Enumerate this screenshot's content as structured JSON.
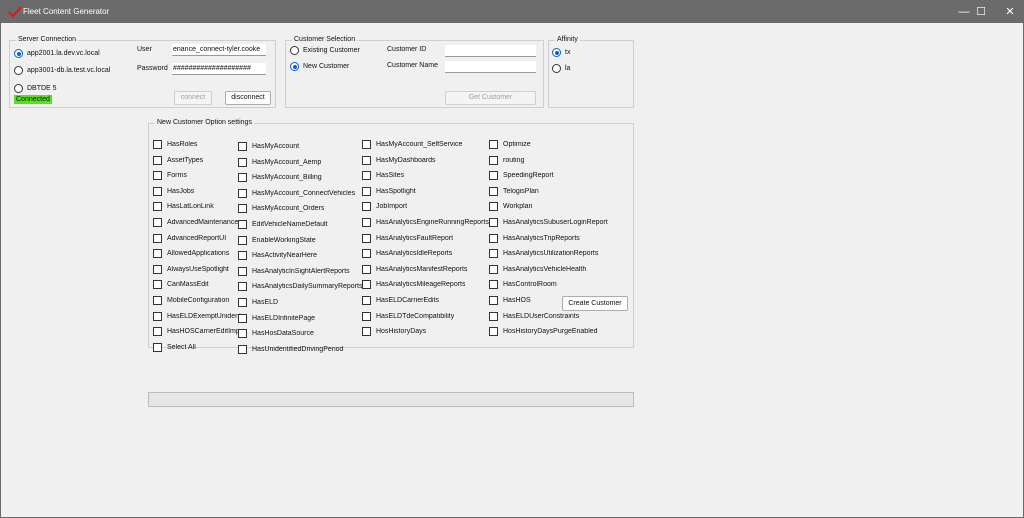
{
  "window": {
    "title": "Fleet Content Generator",
    "minimize": "—",
    "maximize": "☐",
    "close": "✕"
  },
  "server": {
    "group_label": "Server Connection",
    "options": [
      "app2001.la.dev.vc.local",
      "app3001-db.la.test.vc.local",
      "DBTDE 5"
    ],
    "selected": "app2001.la.dev.vc.local",
    "user_label": "User",
    "user_value": "enance_connect-tyler.cooke",
    "password_label": "Password",
    "password_value": "####################",
    "connect_label": "connect",
    "disconnect_label": "disconnect",
    "status": "Connected",
    "status_color": "#56e01f"
  },
  "customer": {
    "group_label": "Customer Selection",
    "options": [
      "Existing Customer",
      "New Customer"
    ],
    "selected": "New Customer",
    "id_label": "Customer ID",
    "id_value": "",
    "name_label": "Customer Name",
    "name_value": "",
    "get_label": "Get Customer"
  },
  "affinity": {
    "group_label": "Affinity",
    "options": [
      "tx",
      "la"
    ],
    "selected": "tx"
  },
  "options": {
    "group_label": "New Customer Option settings",
    "columns": [
      [
        "HasRoles",
        "AssetTypes",
        "Forms",
        "HasJobs",
        "HasLatLonLink",
        "AdvancedMaintenance",
        "AdvancedReportUI",
        "AllowedApplications",
        "AlwaysUseSpotlight",
        "CanMassEdit",
        "MobileConfiguration",
        "HasELDExemptUnidenti",
        "HasHOSCarrierEditImpro",
        "Select All"
      ],
      [
        "HasMyAccount",
        "HasMyAccount_Aemp",
        "HasMyAccount_Billing",
        "HasMyAccount_ConnectVehicles",
        "HasMyAccount_Orders",
        "EditVehicleNameDefault",
        "EnableWorkingState",
        "HasActivityNearHere",
        "HasAnalyticInSightAlertReports",
        "HasAnalyticsDailySummaryReports",
        "HasELD",
        "HasELDInfinitePage",
        "HasHosDataSource",
        "HasUnidentifiedDrivingPeriod"
      ],
      [
        "HasMyAccount_SelfService",
        "HasMyDashboards",
        "HasSites",
        "HasSpotlight",
        "JobImport",
        "HasAnalyticsEngineRunningReports",
        "HasAnalyticsFaultReport",
        "HasAnalyticsIdleReports",
        "HasAnalyticsManifestReports",
        "HasAnalyticsMileageReports",
        "HasELDCarrierEdits",
        "HasELDTdeCompatibility",
        "HosHistoryDays"
      ],
      [
        "Optimize",
        "routing",
        "SpeedingReport",
        "TelogisPlan",
        "Workplan",
        "HasAnalyticsSubuserLoginReport",
        "HasAnalyticsTripReports",
        "HasAnalyticsUtilizationReports",
        "HasAnalyticsVehicleHealth",
        "HasControlRoom",
        "HasHOS",
        "HasELDUserConstraints",
        "HosHistoryDaysPurgeEnabled"
      ]
    ],
    "create_label": "Create Customer"
  },
  "progress": {
    "value": 0
  }
}
